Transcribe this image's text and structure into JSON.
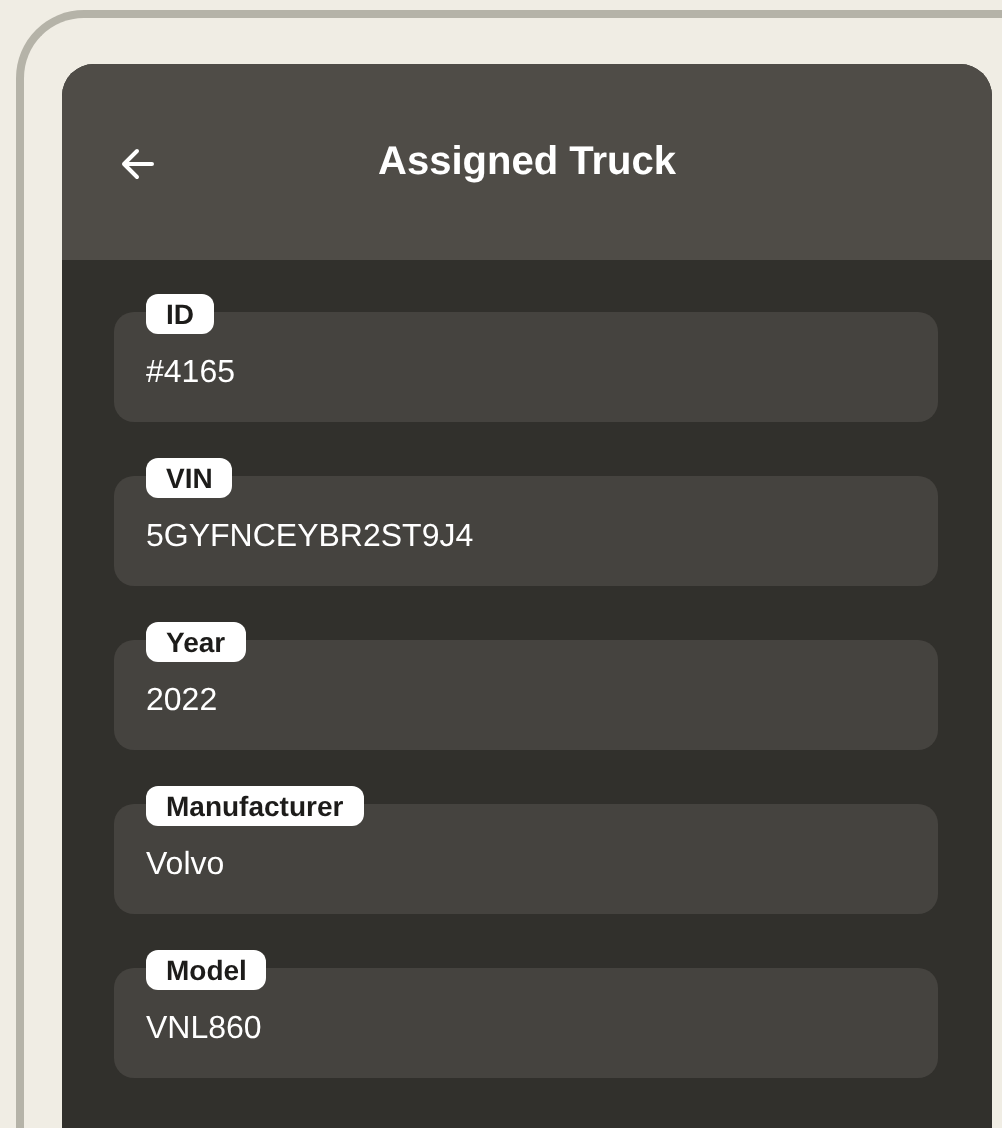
{
  "header": {
    "title": "Assigned Truck"
  },
  "fields": [
    {
      "label": "ID",
      "value": "#4165"
    },
    {
      "label": "VIN",
      "value": "5GYFNCEYBR2ST9J4"
    },
    {
      "label": "Year",
      "value": "2022"
    },
    {
      "label": "Manufacturer",
      "value": "Volvo"
    },
    {
      "label": "Model",
      "value": "VNL860"
    }
  ]
}
